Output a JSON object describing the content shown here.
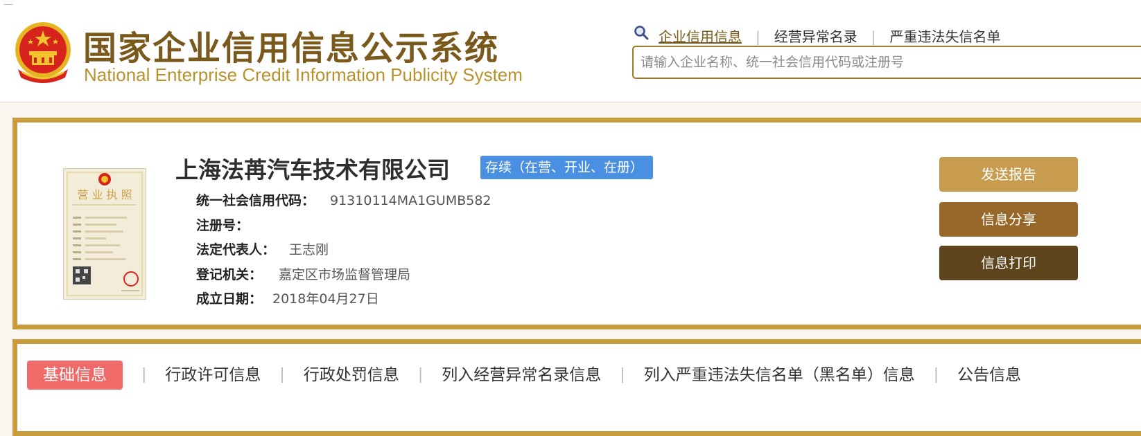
{
  "header": {
    "logo_cn": "国家企业信用信息公示系统",
    "logo_en": "National Enterprise Credit Information Publicity System",
    "links": [
      "企业信用信息",
      "经营异常名录",
      "严重违法失信名单"
    ],
    "search_placeholder": "请输入企业名称、统一社会信用代码或注册号",
    "search_value": ""
  },
  "company": {
    "name": "上海法苒汽车技术有限公司",
    "status": "存续（在营、开业、在册）",
    "fields": [
      {
        "label": "统一社会信用代码：",
        "value": "91310114MA1GUMB582"
      },
      {
        "label": "注册号：",
        "value": ""
      },
      {
        "label": "法定代表人：",
        "value": "王志刚"
      },
      {
        "label": "登记机关：",
        "value": "嘉定区市场监督管理局"
      },
      {
        "label": "成立日期：",
        "value": "2018年04月27日"
      }
    ],
    "license_title": "营 业 执 照"
  },
  "actions": {
    "send": "发送报告",
    "share": "信息分享",
    "print": "信息打印"
  },
  "tabs": [
    {
      "label": "基础信息",
      "active": true
    },
    {
      "label": "行政许可信息",
      "active": false
    },
    {
      "label": "行政处罚信息",
      "active": false
    },
    {
      "label": "列入经营异常名录信息",
      "active": false
    },
    {
      "label": "列入严重违法失信名单（黑名单）信息",
      "active": false
    },
    {
      "label": "公告信息",
      "active": false
    }
  ],
  "colors": {
    "brand_gold": "#c89c3c",
    "brand_brown": "#7a5a1c",
    "status_blue": "#4a90e2",
    "active_tab": "#f06a6a"
  }
}
